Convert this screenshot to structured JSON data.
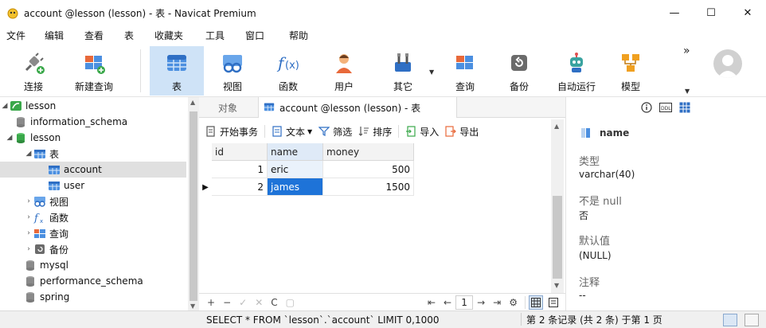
{
  "window": {
    "title": "account @lesson (lesson) - 表 - Navicat Premium",
    "minimize": "—",
    "maximize": "☐",
    "close": "✕"
  },
  "menu": [
    "文件",
    "编辑",
    "查看",
    "表",
    "收藏夹",
    "工具",
    "窗口",
    "帮助"
  ],
  "toolbar": {
    "connect": "连接",
    "new_query": "新建查询",
    "table": "表",
    "view": "视图",
    "function": "函数",
    "user": "用户",
    "other": "其它",
    "query": "查询",
    "backup": "备份",
    "auto_run": "自动运行",
    "model": "模型",
    "more": "»"
  },
  "tree": {
    "items": [
      {
        "label": "lesson"
      },
      {
        "label": "information_schema"
      },
      {
        "label": "lesson"
      },
      {
        "label": "表"
      },
      {
        "label": "account"
      },
      {
        "label": "user"
      },
      {
        "label": "视图"
      },
      {
        "label": "函数"
      },
      {
        "label": "查询"
      },
      {
        "label": "备份"
      },
      {
        "label": "mysql"
      },
      {
        "label": "performance_schema"
      },
      {
        "label": "spring"
      }
    ]
  },
  "tabs": {
    "objects": "对象",
    "active": "account @lesson (lesson) - 表"
  },
  "table_toolbar": {
    "begin_transaction": "开始事务",
    "text": "文本",
    "filter": "筛选",
    "sort": "排序",
    "import": "导入",
    "export": "导出"
  },
  "grid": {
    "columns": [
      "id",
      "name",
      "money"
    ],
    "rows": [
      {
        "id": "1",
        "name": "eric",
        "money": "500"
      },
      {
        "id": "2",
        "name": "james",
        "money": "1500"
      }
    ]
  },
  "navbar": {
    "add": "+",
    "delete": "−",
    "apply": "✓",
    "discard": "✕",
    "refresh": "C",
    "stop": "▢",
    "first": "⇤",
    "prev": "←",
    "page": "1",
    "next": "→",
    "last": "⇥",
    "settings": "⚙"
  },
  "info": {
    "field_name": "name",
    "type_label": "类型",
    "type_value": "varchar(40)",
    "not_null_label": "不是 null",
    "not_null_value": "否",
    "default_label": "默认值",
    "default_value": "(NULL)",
    "comment_label": "注释",
    "comment_value": "--"
  },
  "status": {
    "sql": "SELECT * FROM `lesson`.`account` LIMIT 0,1000",
    "records": "第 2 条记录 (共 2 条) 于第 1 页"
  },
  "colors": {
    "accent": "#1e73d8",
    "active_tool_bg": "#cfe3f7",
    "selected_row_bg": "#e0e0e0"
  }
}
